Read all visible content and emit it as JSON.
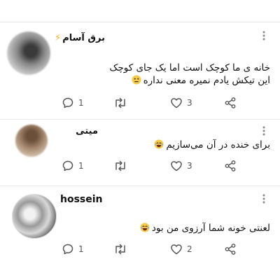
{
  "comments": [
    {
      "name": "برق آسام",
      "badge": "⚡",
      "lines": [
        "خانه ی ما کوچک است اما یک جای کوچک",
        "این تیکش یادم نمیره معنی نداره"
      ],
      "emoji": "neutral-face",
      "replies": "1",
      "retweets": "",
      "likes": "3"
    },
    {
      "name": "میتی",
      "badge": "",
      "lines": [
        "برای خنده در آن می‌سازیم"
      ],
      "emoji": "laughing-face",
      "replies": "1",
      "retweets": "",
      "likes": "3"
    },
    {
      "name": "hossein",
      "badge": "",
      "lines": [
        "لعنتی خونه شما آرزوی من بود"
      ],
      "emoji": "laughing-face",
      "replies": "1",
      "retweets": "",
      "likes": "2"
    }
  ],
  "colors": {
    "icon": "#555555",
    "badge": "#f3b022",
    "emoji": "#f7c948"
  }
}
